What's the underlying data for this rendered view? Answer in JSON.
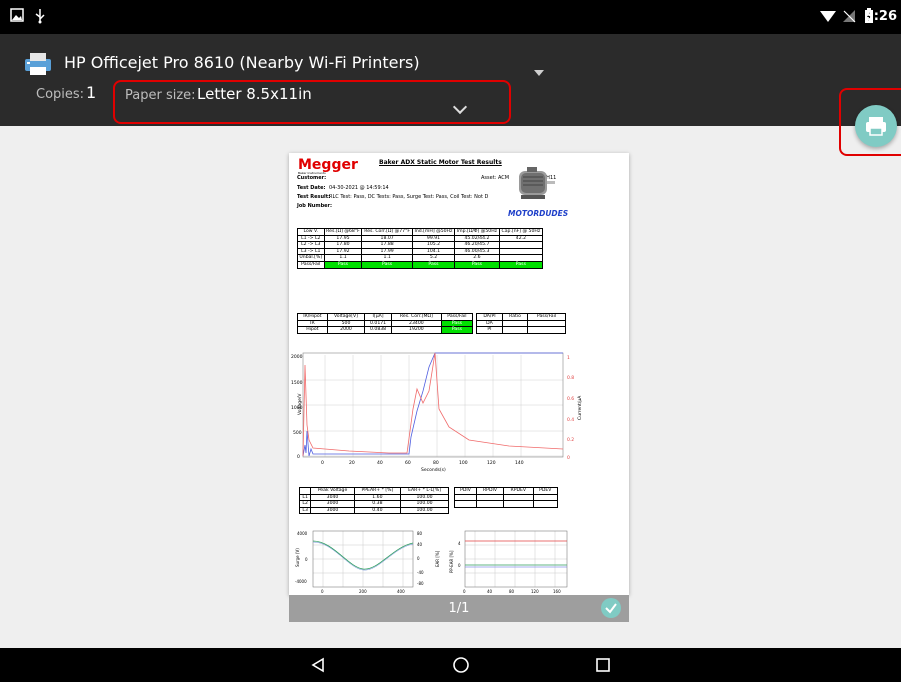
{
  "status_bar": {
    "time": "3:26"
  },
  "print_dialog": {
    "printer_name": "HP Officejet Pro 8610 (Nearby Wi-Fi Printers)",
    "copies_label": "Copies:",
    "copies_value": "1",
    "paper_size_label": "Paper size:",
    "paper_size_value": "Letter 8.5x11in"
  },
  "preview": {
    "page_indicator": "1/1",
    "document": {
      "logo": "Megger",
      "logo_sub": "Baker Instruments",
      "title": "Baker ADX Static Motor Test Results",
      "customer_label": "Customer:",
      "asset_label": "Asset: ACM",
      "asset_suffix": "1H11",
      "test_date_label": "Test Date:",
      "test_date_value": "04-30-2021 @ 14:59:14",
      "test_result_label": "Test Result:",
      "test_result_value": "RLC Test: Pass, DC Tests: Pass, Surge Test: Pass, Coil Test: Not D",
      "job_number_label": "Job Number:",
      "brand": "MOTORDUDES",
      "rlc_table": {
        "header": [
          "Low V.",
          "Res.[Ω]\n@68°F",
          "Res. Corr.[Ω]\n@77°F",
          "Ind.[mH]\n@50Hz",
          "Imp.[Ω/Φ]\n@50Hz",
          "Cap.[nF]\n@ 50Hz"
        ],
        "rows": [
          [
            "L1 -> L2",
            "17.95",
            "18.07",
            "99.91",
            "45.02/44.2",
            "42.2"
          ],
          [
            "L2 -> L3",
            "17.80",
            "17.88",
            "105.2",
            "46.20/45.7",
            ""
          ],
          [
            "L3 -> L1",
            "17.92",
            "17.99",
            "104.1",
            "46.00/45.3",
            ""
          ],
          [
            "Unbal.[%]",
            "1.1",
            "1.1",
            "5.2",
            "2.6",
            ""
          ],
          [
            "Pass/Fail",
            "Pass",
            "Pass",
            "Pass",
            "Pass",
            "Pass"
          ]
        ]
      },
      "ir_table": {
        "header": [
          "IR/Hipot",
          "Voltage[V]",
          "I[μA]",
          "Res. Corr.[MΩ]",
          "Pass/Fail"
        ],
        "rows": [
          [
            "IR",
            "500",
            "0.0171",
            "23400",
            "Pass"
          ],
          [
            "Hipot",
            "2000",
            "0.0838",
            "19200",
            "Pass"
          ]
        ],
        "extra_header": [
          "DA/PI",
          "Ratio",
          "Pass/Fail"
        ],
        "extra_rows": [
          [
            "DA",
            "",
            ""
          ],
          [
            "PI",
            "",
            ""
          ]
        ]
      },
      "chart": {
        "y_left_label": "Voltage/V",
        "y_right_label": "Current/μA",
        "x_label": "Seconds(s)",
        "y_left_ticks": [
          "2000",
          "1500",
          "1000",
          "500",
          "0"
        ],
        "y_right_ticks": [
          "1",
          "0.8",
          "0.6",
          "0.4",
          "0.2",
          "0"
        ],
        "x_ticks": [
          "0",
          "20",
          "40",
          "60",
          "80",
          "100",
          "120",
          "140"
        ]
      },
      "surge_table": {
        "header": [
          "",
          "Peak Voltage",
          "PPEAR+ * [%]",
          "EAR+ * L-L[%]"
        ],
        "rows": [
          [
            "L1",
            "3040",
            "1.60",
            "100.00"
          ],
          [
            "L2",
            "3000",
            "0.38",
            "100.00"
          ],
          [
            "L3",
            "3000",
            "0.40",
            "100.00"
          ]
        ],
        "pd_header": [
          "PDIV",
          "RPDIV",
          "RPDEV",
          "PDEV"
        ]
      },
      "surge_chart": {
        "y_label": "Surge (V)",
        "y_ticks": [
          "4000",
          "0",
          "-4000"
        ],
        "x_ticks": [
          "0",
          "200",
          "400"
        ],
        "y2_label": "EAR [%]",
        "y2_ticks": [
          "80",
          "40",
          "0",
          "-40",
          "-80"
        ]
      },
      "trend_chart": {
        "y_label": "PP-EAR [%]",
        "x_ticks": [
          "0",
          "40",
          "80",
          "120",
          "160"
        ],
        "y_ticks": [
          "4",
          "0"
        ]
      }
    }
  }
}
